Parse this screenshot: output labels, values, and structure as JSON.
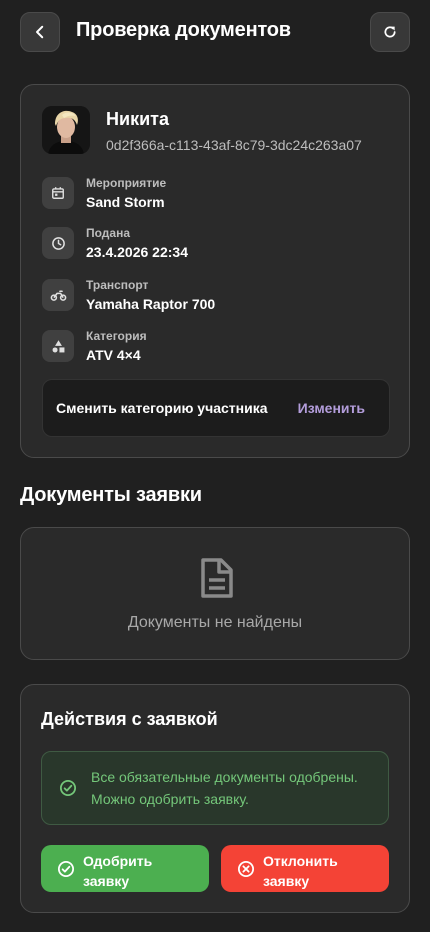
{
  "header": {
    "title": "Проверка документов",
    "back_icon": "chevron-left-icon",
    "refresh_icon": "refresh-icon"
  },
  "participant": {
    "name": "Никита",
    "id": "0d2f366a-c113-43af-8c79-3dc24c263a07",
    "fields": [
      {
        "icon": "calendar-icon",
        "label": "Мероприятие",
        "value": "Sand Storm"
      },
      {
        "icon": "clock-icon",
        "label": "Подана",
        "value": "23.4.2026 22:34"
      },
      {
        "icon": "motorcycle-icon",
        "label": "Транспорт",
        "value": "Yamaha Raptor 700"
      },
      {
        "icon": "category-icon",
        "label": "Категория",
        "value": "ATV 4×4"
      }
    ],
    "change_category": {
      "label": "Сменить категорию участника",
      "action": "Изменить"
    }
  },
  "documents": {
    "title": "Документы заявки",
    "empty_text": "Документы не найдены",
    "icon": "document-icon"
  },
  "actions": {
    "title": "Действия с заявкой",
    "notice_line1": "Все обязательные документы одобрены.",
    "notice_line2": "Можно одобрить заявку.",
    "approve_line1": "Одобрить",
    "approve_line2": "заявку",
    "reject_line1": "Отклонить",
    "reject_line2": "заявку"
  },
  "colors": {
    "background": "#202020",
    "card": "#2a2a2a",
    "accent_link": "#b39ddb",
    "success": "#4caf50",
    "danger": "#f44336",
    "success_text": "#74c77a"
  }
}
